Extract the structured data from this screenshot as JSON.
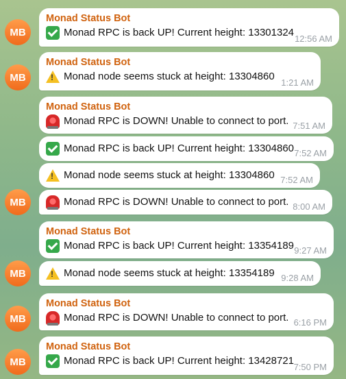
{
  "avatar_initials": "MB",
  "sender_name": "Monad Status Bot",
  "colors": {
    "sender": "#d0620e",
    "avatar": "#f06b1c",
    "time": "#9aa0a6"
  },
  "messages": [
    {
      "icon": "check-icon",
      "text": "Monad RPC is back UP! Current height: 13301324",
      "time": "12:56 AM",
      "show_sender": true,
      "show_avatar": true
    },
    {
      "icon": "warning-icon",
      "text": "Monad node seems stuck at height: 13304860",
      "time": "1:21 AM",
      "show_sender": true,
      "show_avatar": true
    },
    {
      "icon": "siren-icon",
      "text": "Monad RPC is DOWN! Unable to connect to port.",
      "time": "7:51 AM",
      "show_sender": true,
      "show_avatar": false
    },
    {
      "icon": "check-icon",
      "text": "Monad RPC is back UP! Current height: 13304860",
      "time": "7:52 AM",
      "show_sender": false,
      "show_avatar": false
    },
    {
      "icon": "warning-icon",
      "text": "Monad node seems stuck at height: 13304860",
      "time": "7:52 AM",
      "show_sender": false,
      "show_avatar": false
    },
    {
      "icon": "siren-icon",
      "text": "Monad RPC is DOWN! Unable to connect to port.",
      "time": "8:00 AM",
      "show_sender": false,
      "show_avatar": true
    },
    {
      "icon": "check-icon",
      "text": "Monad RPC is back UP! Current height: 13354189",
      "time": "9:27 AM",
      "show_sender": true,
      "show_avatar": false
    },
    {
      "icon": "warning-icon",
      "text": "Monad node seems stuck at height: 13354189",
      "time": "9:28 AM",
      "show_sender": false,
      "show_avatar": true
    },
    {
      "icon": "siren-icon",
      "text": "Monad RPC is DOWN! Unable to connect to port.",
      "time": "6:16 PM",
      "show_sender": true,
      "show_avatar": true
    },
    {
      "icon": "check-icon",
      "text": "Monad RPC is back UP! Current height: 13428721",
      "time": "7:50 PM",
      "show_sender": true,
      "show_avatar": true
    }
  ]
}
